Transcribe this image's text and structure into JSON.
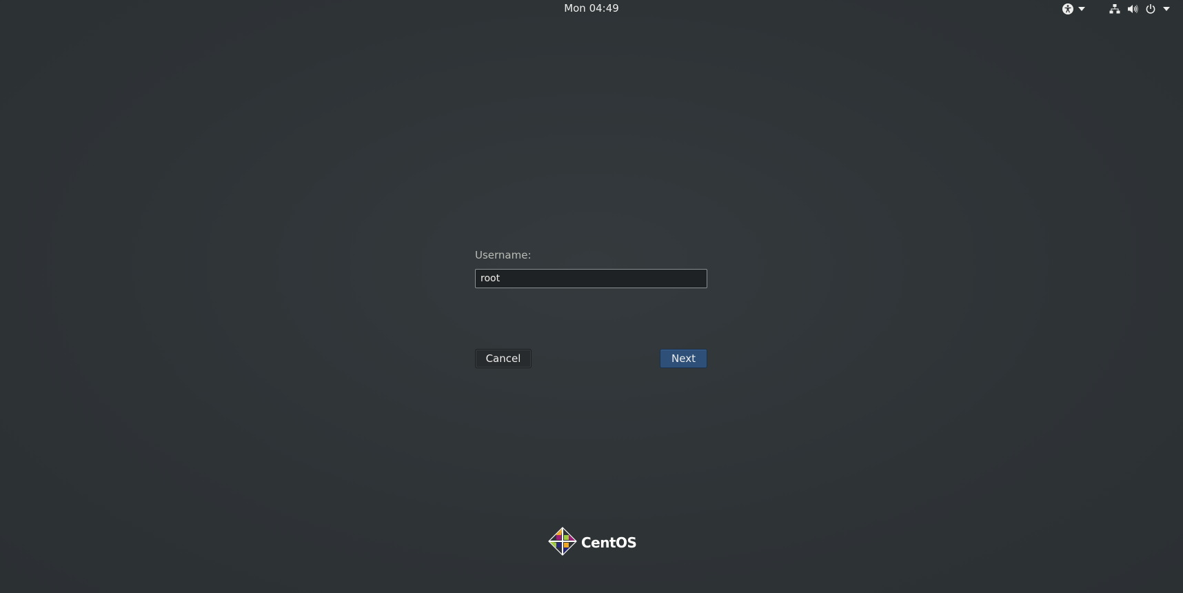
{
  "topbar": {
    "clock": "Mon 04:49",
    "icons": [
      "accessibility-icon",
      "dropdown-arrow-icon",
      "network-wired-icon",
      "volume-icon",
      "power-icon",
      "dropdown-arrow-icon"
    ]
  },
  "login": {
    "username_label": "Username:",
    "username_value": "root",
    "cancel_label": "Cancel",
    "next_label": "Next"
  },
  "branding": {
    "logo_text": "CentOS",
    "logo_colors": [
      "#efa724",
      "#262577",
      "#9c1e77",
      "#932279",
      "#a0cb3e"
    ]
  },
  "colors": {
    "background": "#2f3336",
    "accent": "#2d4f78"
  }
}
